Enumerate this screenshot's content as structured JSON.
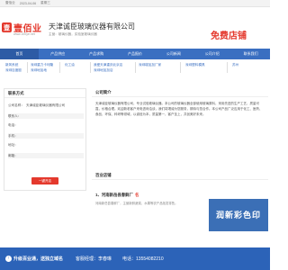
{
  "topbar": {
    "site": "壹佰业",
    "date": "2023-04-06",
    "weekday": "星期三"
  },
  "header": {
    "logo_mark": "壹",
    "logo_text": "壹佰业",
    "logo_url": "www.100ye.net",
    "company": "天津诚臣玻璃仪器有限公司",
    "subtitle": "主营：玻璃仪器，实验室玻璃仪器",
    "free_shop": "免费店铺"
  },
  "nav": [
    "首页",
    "产品供应",
    "产品求购",
    "产品报价",
    "公司新闻",
    "公司介绍",
    "联系我们"
  ],
  "quick": [
    [
      "新风系统",
      "深圳重力卡利隆",
      "化工油",
      "我爱天津重庆北京店",
      "深圳增加加厂家",
      "深圳塑料模具",
      "苏州"
    ],
    [
      "深圳百度股",
      "深圳地加地",
      "深圳地加加店"
    ]
  ],
  "contact": {
    "title": "联系方式",
    "rows": [
      {
        "label": "公司名称：",
        "value": "天津诚臣玻璃仪器有限公司"
      },
      {
        "label": "联系人：",
        "value": ""
      },
      {
        "label": "电话：",
        "value": ""
      },
      {
        "label": "手机：",
        "value": ""
      },
      {
        "label": "地址：",
        "value": ""
      },
      {
        "label": "邮箱：",
        "value": ""
      }
    ],
    "button": "一键开店"
  },
  "intro": {
    "title": "公司简介",
    "text": "天津诚臣玻璃仪器有限公司，专业试验玻璃仪器。本公司的玻璃仪器全部使用玻璃原料，采用先进的生产工艺，质量可靠，价格合理。欢迎新老客户来电咨询洽谈，我们将竭诚为您服务，期待与您合作。本公司产品广泛应用于化工、医药、食品、环保、科研等领域，以诚信为本，质量第一，客户至上，共创美好未来。"
  },
  "stores": {
    "title": "百业店铺",
    "item_title": "1、河南新岳县春鲜厂",
    "item_badge": "名",
    "item_desc": "河南新岳县春鲜厂，主营新鲜蔬菜、水果等农产品批发零售。",
    "banner": "润新彩色印"
  },
  "bottom": {
    "upgrade": "升级百业通，送独立域名",
    "manager": "客服经理：李春琳",
    "phone": "电话：13554082210"
  }
}
